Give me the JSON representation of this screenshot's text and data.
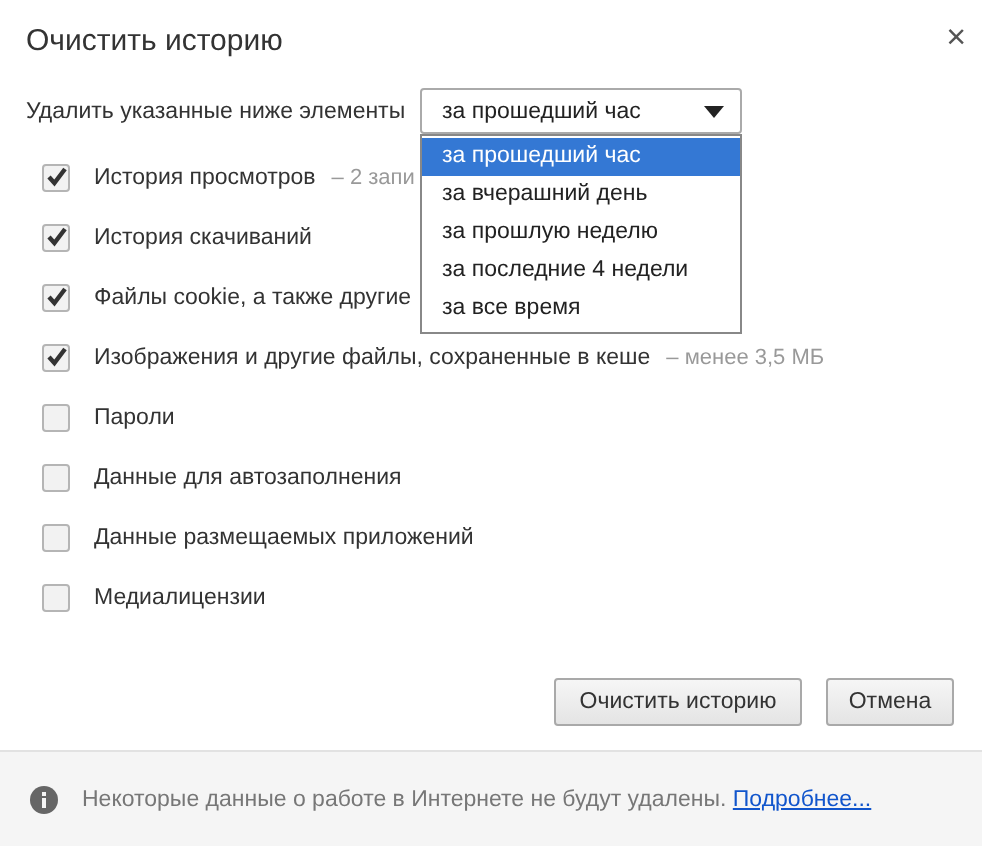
{
  "dialog": {
    "title": "Очистить историю",
    "close": "×"
  },
  "range": {
    "label": "Удалить указанные ниже элементы",
    "value": "за прошедший час",
    "expanded": true,
    "options": [
      {
        "label": "за прошедший час",
        "selected": true
      },
      {
        "label": "за вчерашний день",
        "selected": false
      },
      {
        "label": "за прошлую неделю",
        "selected": false
      },
      {
        "label": "за последние 4 недели",
        "selected": false
      },
      {
        "label": "за все время",
        "selected": false
      }
    ]
  },
  "items": [
    {
      "label": "История просмотров",
      "detail": "– 2 запи",
      "checked": true
    },
    {
      "label": "История скачиваний",
      "checked": true
    },
    {
      "label": "Файлы cookie, а также другие",
      "checked": true
    },
    {
      "label": "Изображения и другие файлы, сохраненные в кеше",
      "detail": "– менее 3,5 МБ",
      "checked": true
    },
    {
      "label": "Пароли",
      "checked": false
    },
    {
      "label": "Данные для автозаполнения",
      "checked": false
    },
    {
      "label": "Данные размещаемых приложений",
      "checked": false
    },
    {
      "label": "Медиалицензии",
      "checked": false
    }
  ],
  "buttons": [
    "Очистить историю",
    "Отмена"
  ],
  "footer": {
    "text": "Некоторые данные о работе в Интернете не будут удалены.",
    "link": "Подробнее..."
  }
}
